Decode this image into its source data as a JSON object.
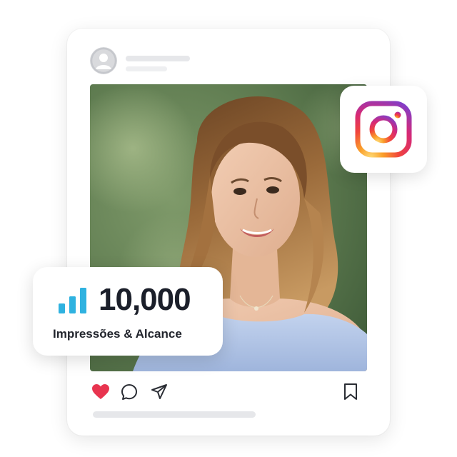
{
  "colors": {
    "accent_bars": "#2fb2e0",
    "like_heart": "#e8344f",
    "ig_gradient": [
      "#feda75",
      "#fa7e1e",
      "#d62976",
      "#962fbf",
      "#4f5bd5"
    ],
    "text_dark": "#1b1f2a",
    "placeholder": "#e6e7ea"
  },
  "post": {
    "avatar_icon": "user-icon",
    "actions": {
      "like_icon": "heart-icon",
      "comment_icon": "comment-icon",
      "share_icon": "send-icon",
      "save_icon": "bookmark-icon"
    }
  },
  "badge": {
    "icon": "instagram-icon"
  },
  "stats": {
    "icon": "bar-chart-icon",
    "value": "10,000",
    "label": "Impressões & Alcance"
  }
}
